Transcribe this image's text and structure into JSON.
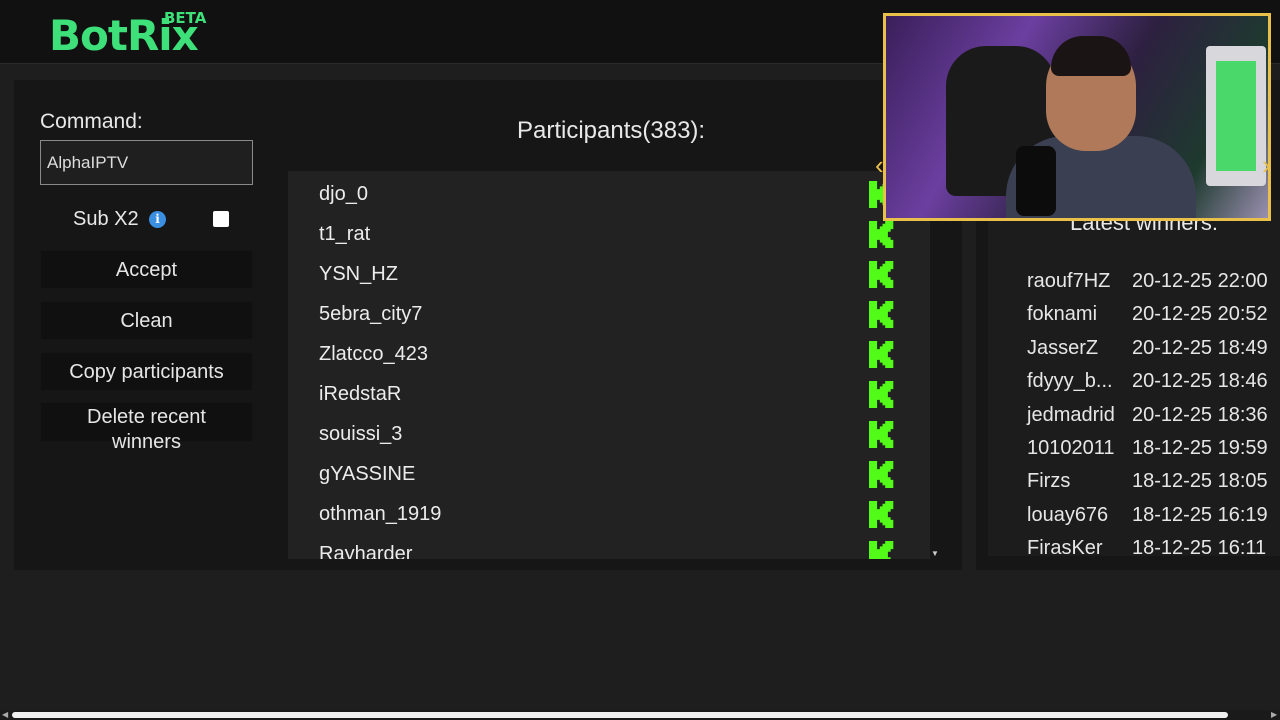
{
  "app": {
    "logo": "BotRix",
    "beta": "BETA"
  },
  "command": {
    "label": "Command:",
    "value": "AlphaIPTV"
  },
  "sub_x2": {
    "label": "Sub X2",
    "checked": false
  },
  "buttons": {
    "accept": "Accept",
    "clean": "Clean",
    "copy": "Copy participants",
    "delete_line1": "Delete recent",
    "delete_line2": "winners"
  },
  "participants": {
    "title": "Participants(383):",
    "list": [
      "djo_0",
      "t1_rat",
      "YSN_HZ",
      "5ebra_city7",
      "Zlatcco_423",
      "iRedstaR",
      "souissi_3",
      "gYASSINE",
      "othman_1919",
      "Rayharder"
    ]
  },
  "winners": {
    "title": "Latest winners:",
    "list": [
      {
        "name": "raouf7HZ",
        "date": "20-12-25 22:00"
      },
      {
        "name": "foknami",
        "date": "20-12-25 20:52"
      },
      {
        "name": "JasserZ",
        "date": "20-12-25 18:49"
      },
      {
        "name": "fdyyy_b...",
        "date": "20-12-25 18:46"
      },
      {
        "name": "jedmadrid",
        "date": "20-12-25 18:36"
      },
      {
        "name": "10102011",
        "date": "18-12-25 19:59"
      },
      {
        "name": "Firzs",
        "date": "18-12-25 18:05"
      },
      {
        "name": "louay676",
        "date": "18-12-25 16:19"
      },
      {
        "name": "FirasKer",
        "date": "18-12-25 16:11"
      }
    ]
  },
  "colors": {
    "brand": "#3ee07a",
    "kick_green": "#53fc18",
    "info_blue": "#3b8fe0"
  },
  "icons": {
    "platform": "kick-logo-icon",
    "info": "info-icon"
  }
}
